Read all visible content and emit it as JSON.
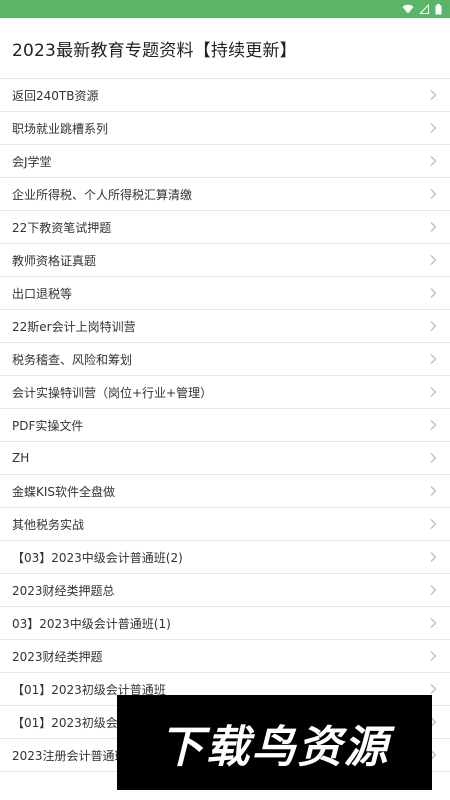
{
  "status_bar": {
    "color": "#5bb568",
    "icons": [
      "wifi-icon",
      "signal-icon",
      "battery-icon"
    ]
  },
  "header": {
    "title": "2023最新教育专题资料【持续更新】"
  },
  "list": {
    "items": [
      {
        "label": "返回240TB资源"
      },
      {
        "label": "职场就业跳槽系列"
      },
      {
        "label": "会J学堂"
      },
      {
        "label": "企业所得税、个人所得税汇算清缴"
      },
      {
        "label": "22下教资笔试押题"
      },
      {
        "label": "教师资格证真题"
      },
      {
        "label": "出口退税等"
      },
      {
        "label": "22斯er会计上岗特训营"
      },
      {
        "label": "税务稽查、风险和筹划"
      },
      {
        "label": "会计实操特训营（岗位+行业+管理）"
      },
      {
        "label": "PDF实操文件"
      },
      {
        "label": "ZH"
      },
      {
        "label": "金蝶KIS软件全盘做"
      },
      {
        "label": "其他税务实战"
      },
      {
        "label": "【03】2023中级会计普通班(2)"
      },
      {
        "label": "2023财经类押题总"
      },
      {
        "label": "03】2023中级会计普通班(1)"
      },
      {
        "label": "2023财经类押题"
      },
      {
        "label": "【01】2023初级会计普通班"
      },
      {
        "label": "【01】2023初级会计普通班"
      },
      {
        "label": "2023注册会计普通班"
      }
    ]
  },
  "watermark": {
    "text": "下载鸟资源"
  }
}
